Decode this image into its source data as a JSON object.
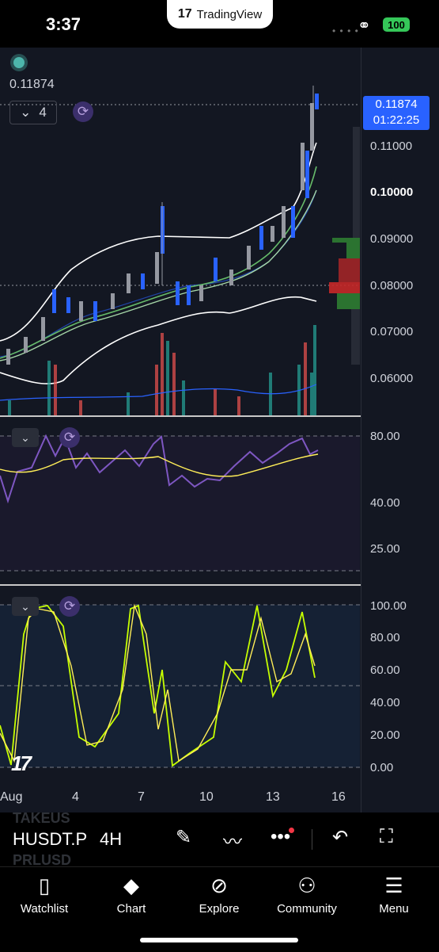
{
  "status_bar": {
    "time": "3:37",
    "app_pill": "TradingView",
    "battery": "100"
  },
  "main_pane": {
    "last_price": "0.11874",
    "collapse_count": "4",
    "price_badge": "0.11874",
    "countdown": "01:22:25",
    "price_labels": [
      "0.11000",
      "0.10000",
      "0.09000",
      "0.08000",
      "0.07000",
      "0.06000"
    ],
    "highlighted_label": "0.10000"
  },
  "rsi_pane": {
    "axis_labels": [
      "80.00",
      "40.00",
      "25.00"
    ]
  },
  "stoch_pane": {
    "axis_labels": [
      "100.00",
      "80.00",
      "60.00",
      "40.00",
      "20.00",
      "0.00"
    ]
  },
  "time_axis": {
    "labels": [
      "Aug",
      "4",
      "7",
      "10",
      "13",
      "16"
    ]
  },
  "toolbar": {
    "symbol": "HUSDT.P",
    "interval": "4H",
    "ghost_top": "TAKEUS",
    "ghost_bottom": "PRLUSD"
  },
  "nav": {
    "items": [
      {
        "label": "Watchlist",
        "icon": "book-icon"
      },
      {
        "label": "Chart",
        "icon": "chart-icon"
      },
      {
        "label": "Explore",
        "icon": "compass-icon"
      },
      {
        "label": "Community",
        "icon": "people-icon"
      },
      {
        "label": "Menu",
        "icon": "hamburger-icon"
      }
    ]
  },
  "colors": {
    "background": "#131722",
    "accent_blue": "#2962ff",
    "up": "#26a69a",
    "down": "#ef5350",
    "rsi_line": "#7e57c2",
    "stoch_k": "#c6ff00",
    "stoch_d": "#ffee58"
  }
}
